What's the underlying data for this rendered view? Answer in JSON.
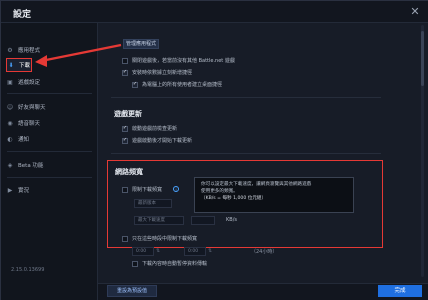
{
  "window": {
    "title": "設定"
  },
  "sidebar": {
    "items": [
      {
        "label": "應用程式",
        "icon": "app-icon"
      },
      {
        "label": "下載",
        "icon": "download-icon",
        "active": true
      },
      {
        "label": "遊戲設定",
        "icon": "game-settings-icon"
      },
      {
        "label": "好友與聊天",
        "icon": "friends-chat-icon"
      },
      {
        "label": "語音聊天",
        "icon": "voice-chat-icon"
      },
      {
        "label": "通知",
        "icon": "notification-icon"
      },
      {
        "label": "Beta 功能",
        "icon": "beta-icon"
      },
      {
        "label": "實況",
        "icon": "stream-icon"
      }
    ],
    "version": "2.15.0.13699"
  },
  "content": {
    "top_button": "管理應用程式",
    "general_options": [
      {
        "label": "關閉遊戲後，若當前沒有其他 Battle.net 遊戲",
        "checked": false
      },
      {
        "label": "安裝時依數據立刻新增捷徑",
        "checked": true
      },
      {
        "label": "為電腦上的所有使用者建立桌面捷徑",
        "checked": true
      }
    ],
    "game_updates": {
      "title": "遊戲更新",
      "options": [
        {
          "label": "啟動遊戲前檢查更新",
          "checked": true
        },
        {
          "label": "遊戲啟動後才開始下載更新",
          "checked": true
        }
      ]
    },
    "network": {
      "title": "網路頻寬",
      "limit_label": "限制下載頻寬",
      "limit_checked": false,
      "field1_placeholder": "最新版本",
      "field2_placeholder": "最大下載速度",
      "unit": "KB/s",
      "tooltip_line1": "你可以設定最大下載速度，讓網頁瀏覽與其他網路遊戲",
      "tooltip_line2": "使用更多的頻寬。",
      "tooltip_line3": "（KB/s = 每秒 1,000 位元組）",
      "schedule_label": "只在這些時段中限制下載頻寬",
      "schedule_checked": false,
      "time_from": "0:00",
      "time_to": "0:00",
      "time_hint": "（24小時）",
      "pause_label": "下載內容時自動暫停資料傳輸"
    }
  },
  "footer": {
    "reset_label": "重設為預設值",
    "done_label": "完成"
  }
}
